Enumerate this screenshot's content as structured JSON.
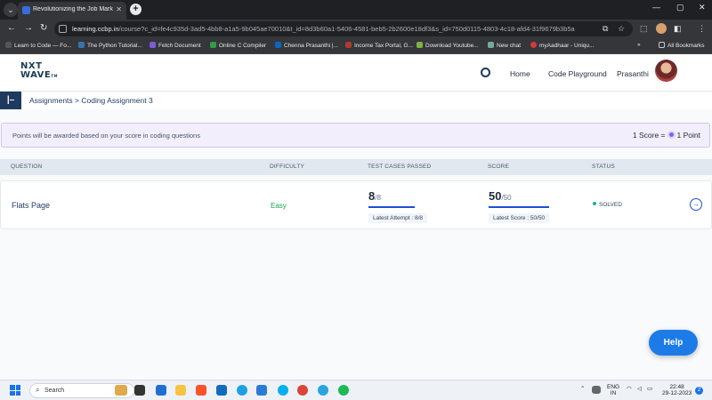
{
  "browser": {
    "tab_title": "Revolutionizing the Job Market",
    "url_host": "learning.ccbp.in",
    "url_path": "/course?c_id=fe4c935d-3ad5-4bb8-a1a5-9b045ae70010&t_id=8d3b60a1-5406-4581-beb5-2b2600e18df3&s_id=750d0115-4803-4c18-afd4-31f9679b3b5a",
    "bookmarks": [
      "Learn to Code — Fo...",
      "The Python Tutorial...",
      "Fetch Document",
      "Online C Compiler",
      "Chenna Prasanthi |...",
      "Income Tax Portal, G...",
      "Download Youtube...",
      "New chat",
      "myAadhaar - Uniqu...",
      "All Bookmarks"
    ]
  },
  "header": {
    "logo_top": "NXT",
    "logo_bottom": "WAVE",
    "logo_tm": "TM",
    "nav": [
      "Home",
      "Code Playground"
    ],
    "username": "Prasanthi"
  },
  "breadcrumb": "Assignments > Coding Assignment 3",
  "notice": {
    "text": "Points will be awarded based on your score in coding questions",
    "left_value": "1 Score =",
    "right_value": "1 Point"
  },
  "table": {
    "headers": [
      "QUESTION",
      "DIFFICULTY",
      "TEST CASES PASSED",
      "SCORE",
      "STATUS"
    ],
    "rows": [
      {
        "question": "Flats Page",
        "difficulty": "Easy",
        "passed": "8",
        "passed_total": "/8",
        "passed_note": "Latest Attempt : 8/8",
        "score": "50",
        "score_total": "/50",
        "score_note": "Latest Score : 50/50",
        "status": "SOLVED"
      }
    ]
  },
  "help_label": "Help",
  "taskbar": {
    "search": "Search",
    "lang_top": "ENG",
    "lang_bottom": "IN",
    "time": "22:48",
    "date": "29-12-2023",
    "notif_count": "2"
  },
  "colors": {
    "brand_navy": "#1e3a5f",
    "accent_blue": "#1d7be8",
    "easy_green": "#16a34a",
    "solved_dot": "#10b981"
  }
}
